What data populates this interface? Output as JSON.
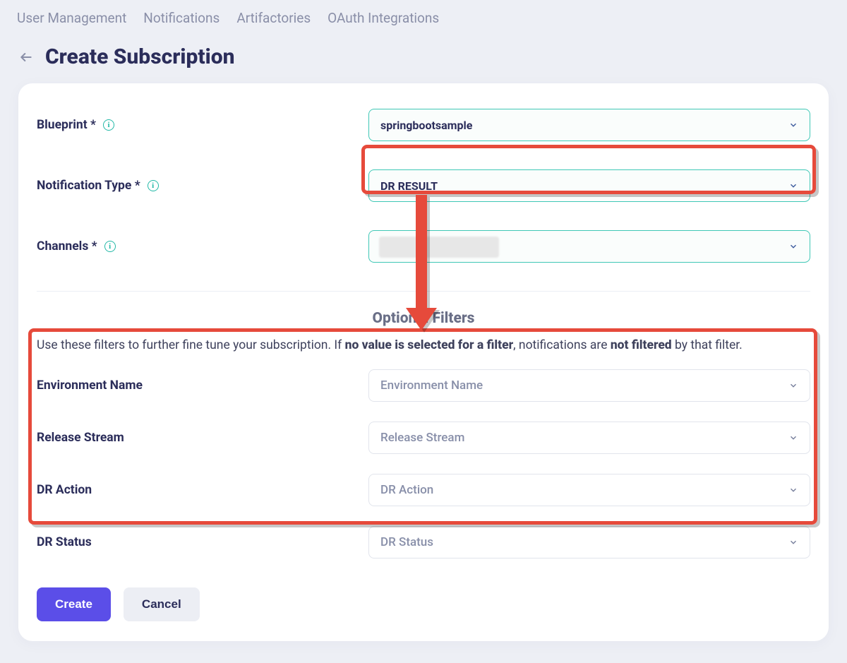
{
  "nav": {
    "items": [
      "User Management",
      "Notifications",
      "Artifactories",
      "OAuth Integrations"
    ]
  },
  "page": {
    "title": "Create Subscription"
  },
  "form": {
    "blueprint": {
      "label": "Blueprint",
      "required": "*",
      "value": "springbootsample"
    },
    "notification_type": {
      "label": "Notification Type",
      "required": "*",
      "value": "DR RESULT"
    },
    "channels": {
      "label": "Channels",
      "required": "*",
      "value": ""
    }
  },
  "filters": {
    "title": "Optional Filters",
    "help_pre": "Use these filters to further fine tune your subscription. If ",
    "help_bold1": "no value is selected for a filter",
    "help_mid": ", notifications are ",
    "help_bold2": "not filtered",
    "help_post": " by that filter.",
    "env": {
      "label": "Environment Name",
      "placeholder": "Environment Name"
    },
    "release": {
      "label": "Release Stream",
      "placeholder": "Release Stream"
    },
    "dr_action": {
      "label": "DR Action",
      "placeholder": "DR Action"
    },
    "dr_status": {
      "label": "DR Status",
      "placeholder": "DR Status"
    }
  },
  "buttons": {
    "create": "Create",
    "cancel": "Cancel"
  }
}
